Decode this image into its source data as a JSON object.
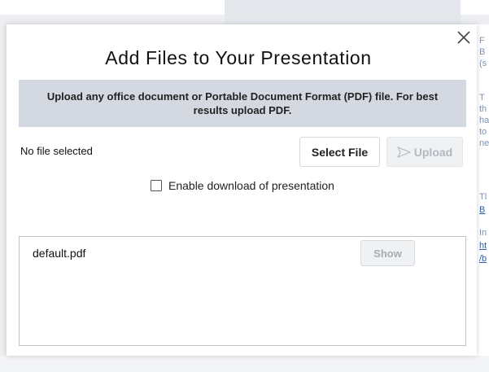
{
  "background": {
    "side_text": [
      {
        "text": "F",
        "link": false
      },
      {
        "text": "B",
        "link": false
      },
      {
        "text": "(s",
        "link": false
      },
      {
        "text": "T",
        "link": false
      },
      {
        "text": "th",
        "link": false
      },
      {
        "text": "ha",
        "link": false
      },
      {
        "text": "to",
        "link": false
      },
      {
        "text": "ne",
        "link": false
      },
      {
        "text": "Tl",
        "link": false
      },
      {
        "text": "B",
        "link": true
      },
      {
        "text": "In",
        "link": false
      },
      {
        "text": "ht",
        "link": true
      },
      {
        "text": "/b",
        "link": true
      }
    ]
  },
  "modal": {
    "title": "Add Files to Your Presentation",
    "notice": "Upload any office document or Portable Document Format (PDF) file.  For best results upload PDF.",
    "file_status": "No file selected",
    "select_label": "Select File",
    "upload_label": "Upload",
    "enable_download_label": "Enable download of presentation",
    "enable_download_checked": false,
    "files": [
      {
        "name": "default.pdf",
        "action_label": "Show"
      }
    ]
  },
  "colors": {
    "notice_bg": "#d4d9e1",
    "disabled_text": "#b3b8c0",
    "side_text": "#7a93b8",
    "side_link": "#2f5fae"
  },
  "icons": {
    "close": "close-icon",
    "upload": "send-arrow-icon"
  }
}
